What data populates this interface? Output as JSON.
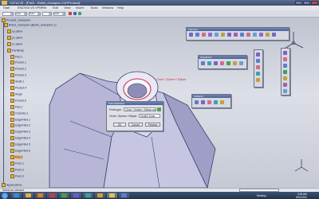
{
  "window": {
    "title": "CATIA V5 - [Part1 - Bullet_champion.CATProduct]"
  },
  "menus": [
    "Start",
    "ENOVIA V5 VPM",
    "File",
    "Edit",
    "View",
    "Insert",
    "Tools",
    "Window",
    "Help"
  ],
  "toolbar": {
    "combo1": "",
    "combo2": "Auto",
    "combo3": "Auto",
    "combo4": "",
    "combo5": "Auto"
  },
  "tree": {
    "root": "Product_champion",
    "items": [
      "Bullet_champion (Bullet_champion.1)",
      "xy plane",
      "yz plane",
      "zx plane",
      "PartBody",
      "Pad.1",
      "Pocket.1",
      "Pocket.2",
      "Pocket.3",
      "Shaft.1",
      "Pocket.4",
      "Angle",
      "Pocket.5",
      "Pad.2",
      "Chamfer.1",
      "EdgeFillet.1",
      "EdgeFillet.2",
      "EdgeFillet.3",
      "EdgeFillet.4",
      "EdgeFillet.5",
      "EdgeFillet.6",
      "Pad.3",
      "Point.1",
      "Point.2",
      "Point.3"
    ],
    "selected_index": 21,
    "footer": "Applications"
  },
  "viewport": {
    "annotation": "Circle / Sphere / Ellipse"
  },
  "panels": {
    "volumes": "Volumes",
    "operations": "Operations",
    "surfaces": "Surfaces"
  },
  "dialog": {
    "title": "Point Definition",
    "point_type_label": "Point type:",
    "point_type_value": "Circle / Sphere / Ellipse center",
    "circle_label": "Circle / Sphere / Ellipse:",
    "circle_value": "Shaft\\2 Edge",
    "ok": "OK",
    "cancel": "Cancel",
    "preview": "Preview"
  },
  "status": {
    "text": "Select an element"
  },
  "taskbar": {
    "desktop": "Desktop",
    "time": "3:06 AM",
    "date": "5/31/2011"
  },
  "colors": {
    "accent": "#4d6396",
    "selected_row": "#f0b470",
    "annotation": "#d0304a"
  }
}
